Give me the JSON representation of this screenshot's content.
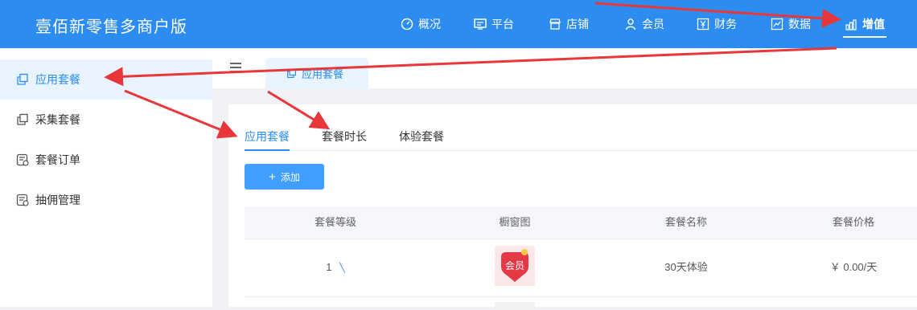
{
  "brand": "壹佰新零售多商户版",
  "nav": [
    {
      "label": "概况",
      "icon": "dashboard-icon"
    },
    {
      "label": "平台",
      "icon": "monitor-icon"
    },
    {
      "label": "店铺",
      "icon": "store-icon"
    },
    {
      "label": "会员",
      "icon": "user-icon"
    },
    {
      "label": "财务",
      "icon": "yen-icon"
    },
    {
      "label": "数据",
      "icon": "chart-icon"
    },
    {
      "label": "增值",
      "icon": "bar-chart-icon",
      "active": true
    }
  ],
  "sidebar": {
    "items": [
      {
        "label": "应用套餐",
        "icon": "copy-icon",
        "active": true
      },
      {
        "label": "采集套餐",
        "icon": "copy-icon"
      },
      {
        "label": "套餐订单",
        "icon": "order-icon"
      },
      {
        "label": "抽佣管理",
        "icon": "order-icon"
      }
    ]
  },
  "page_tab": {
    "label": "应用套餐"
  },
  "subtabs": [
    {
      "label": "应用套餐",
      "active": true
    },
    {
      "label": "套餐时长"
    },
    {
      "label": "体验套餐"
    }
  ],
  "add_button": {
    "icon": "+",
    "label": "添加"
  },
  "table": {
    "columns": [
      "套餐等级",
      "橱窗图",
      "套餐名称",
      "套餐价格"
    ],
    "rows": [
      {
        "level": "1",
        "image_text": "会员",
        "name": "30天体验",
        "price": "￥ 0.00/天"
      }
    ]
  },
  "colors": {
    "primary": "#2d8cf0",
    "button": "#409eff",
    "arrow": "#e8373a"
  }
}
